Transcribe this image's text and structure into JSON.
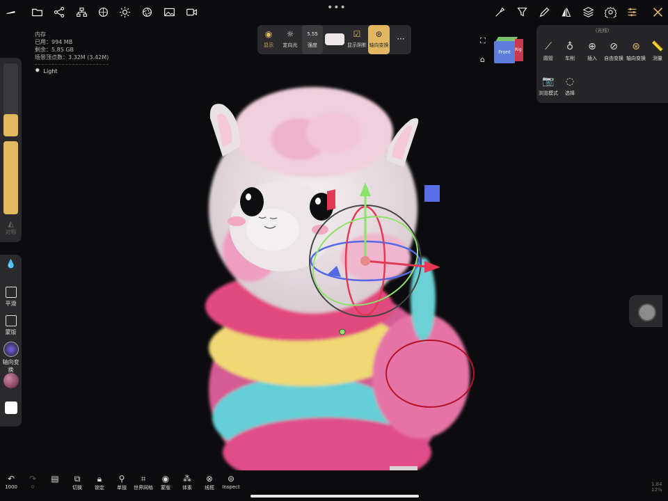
{
  "topbar": {
    "left_icons": [
      "brush-icon",
      "folder-icon",
      "share-graph-icon",
      "scene-tree-icon",
      "material-ball-icon",
      "sun-icon",
      "aperture-icon",
      "image-icon",
      "video-camera-icon"
    ],
    "right_icons": [
      "pick-color-icon",
      "filter-icon",
      "pen-icon",
      "symmetry-icon",
      "layers-icon",
      "gear-icon",
      "sliders-icon",
      "tools-cross-icon"
    ],
    "center_dots": "•••"
  },
  "stats": {
    "heading": "内存",
    "used": "已用：994 MB",
    "remaining": "剩余：5.85 GB",
    "vertices": "场景顶点数：3.32M (3.42M)",
    "light_label": "Light"
  },
  "left_panel": {
    "slider_small_level": 1.0,
    "slider_large_level": 1.0,
    "symmetry_label": "对称",
    "buttons": [
      {
        "label": "平滑",
        "icon": "smooth-icon"
      },
      {
        "label": "蒙版",
        "icon": "mask-icon"
      },
      {
        "label": "轴向变换",
        "icon": "gizmo-icon"
      }
    ],
    "material_color": "#8c4a67",
    "paint_color": "#ffffff"
  },
  "light_toolbar": {
    "items": [
      {
        "label": "显示",
        "icon": "eye-icon"
      },
      {
        "label": "定向光",
        "icon": "sun-icon"
      },
      {
        "label": "强度",
        "value": "5.55"
      },
      {
        "label": "",
        "icon": "color-swatch"
      },
      {
        "label": "显示阴影",
        "icon": "checkbox-icon"
      },
      {
        "label": "轴向变换",
        "icon": "gizmo-icon",
        "active": true
      }
    ],
    "more": "···"
  },
  "right_panel": {
    "title": "(光线)",
    "row1": [
      {
        "label": "圆管",
        "icon": "curve-icon"
      },
      {
        "label": "车削",
        "icon": "lathe-icon"
      },
      {
        "label": "插入",
        "icon": "insert-icon"
      },
      {
        "label": "自由变换",
        "icon": "free-transform-icon"
      },
      {
        "label": "轴向变换",
        "icon": "gizmo-icon"
      },
      {
        "label": "测量",
        "icon": "ruler-icon"
      }
    ],
    "row2": [
      {
        "label": "浏览模式",
        "icon": "camera-icon"
      },
      {
        "label": "选择",
        "icon": "lasso-icon"
      }
    ]
  },
  "navcube": {
    "front_label": "Front",
    "right_label": "Rig"
  },
  "bottom_bar": [
    {
      "label": "1000",
      "icon": "undo-icon"
    },
    {
      "label": "0",
      "icon": "redo-icon"
    },
    {
      "label": "",
      "icon": "document-icon"
    },
    {
      "label": "切换",
      "icon": "switch-icon"
    },
    {
      "label": "锁定",
      "icon": "lock-icon"
    },
    {
      "label": "单独",
      "icon": "solo-icon"
    },
    {
      "label": "世界网格",
      "icon": "grid-icon"
    },
    {
      "label": "蒙版",
      "icon": "eye-icon"
    },
    {
      "label": "体素",
      "icon": "voxel-icon"
    },
    {
      "label": "线框",
      "icon": "wireframe-icon"
    },
    {
      "label": "Inspect",
      "icon": "inspect-icon"
    }
  ],
  "fps": {
    "line1": "1.84",
    "line2": "12%"
  },
  "colors": {
    "accent": "#e3b761",
    "background": "#0c0b0d",
    "panel": "#2b2a2d"
  }
}
